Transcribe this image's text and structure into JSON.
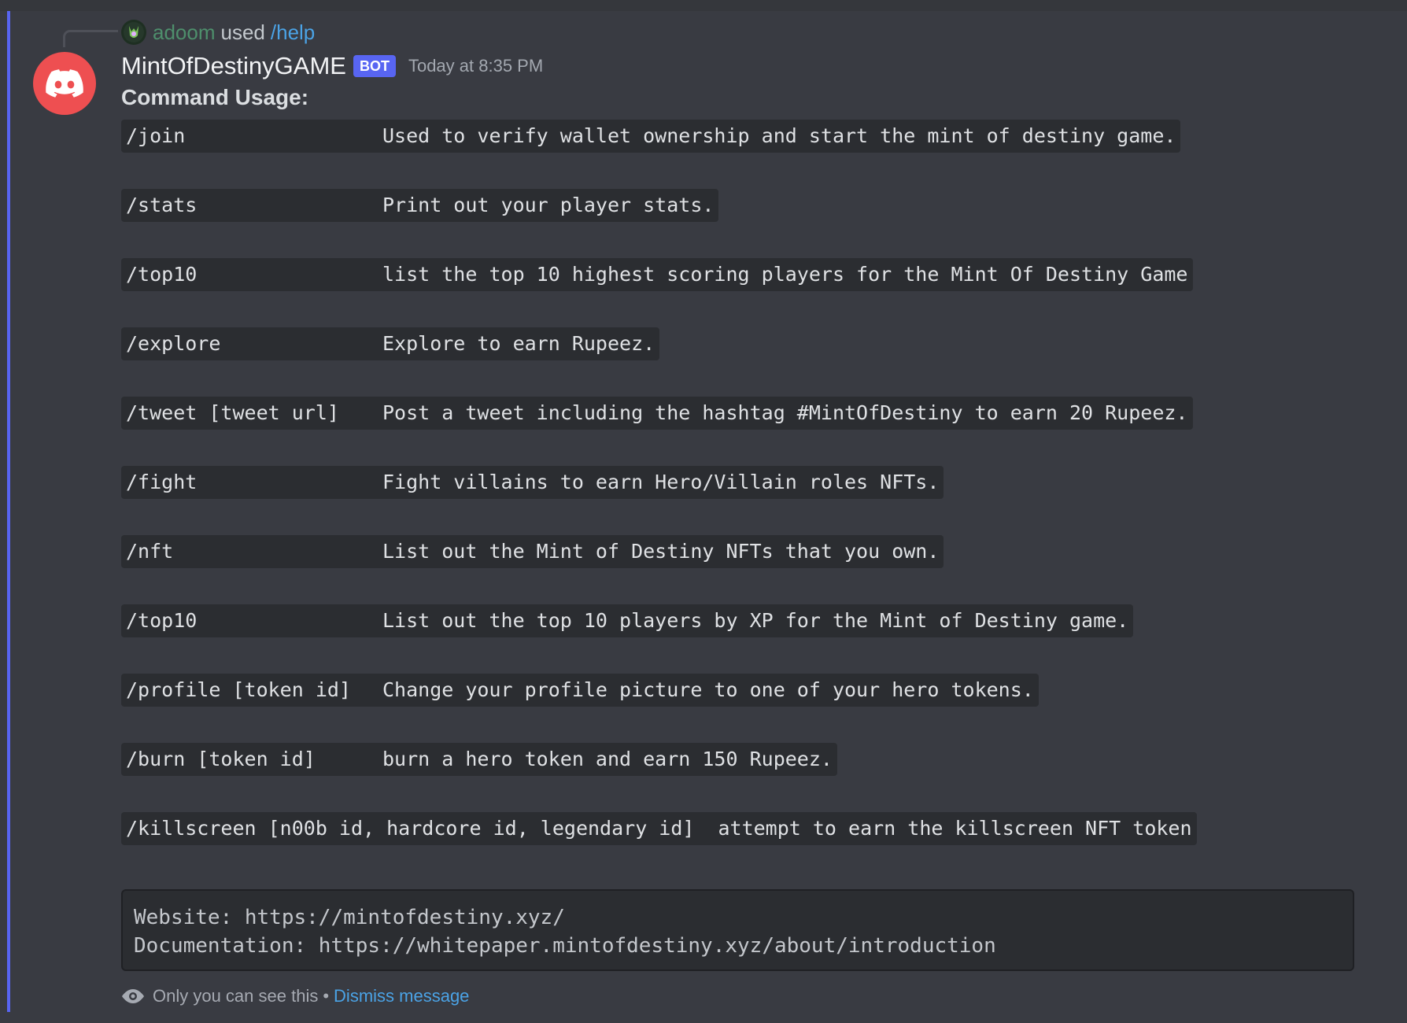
{
  "reply": {
    "username": "adoom",
    "used_text": "used",
    "command": "/help"
  },
  "message": {
    "author": "MintOfDestinyGAME",
    "bot_tag": "BOT",
    "timestamp": "Today at 8:35 PM",
    "title": "Command Usage:",
    "commands": [
      {
        "name": "/join",
        "description": "Used to verify wallet ownership and start the mint of destiny game."
      },
      {
        "name": "/stats",
        "description": "Print out your player stats."
      },
      {
        "name": "/top10",
        "description": "list the top 10 highest scoring players for the Mint Of Destiny Game"
      },
      {
        "name": "/explore",
        "description": "Explore to earn Rupeez."
      },
      {
        "name": "/tweet [tweet url]",
        "description": "Post a tweet including the hashtag #MintOfDestiny to earn 20 Rupeez."
      },
      {
        "name": "/fight",
        "description": "Fight villains to earn Hero/Villain roles NFTs."
      },
      {
        "name": "/nft",
        "description": "List out the Mint of Destiny NFTs that you own."
      },
      {
        "name": "/top10",
        "description": "List out the top 10 players by XP for the Mint of Destiny game."
      },
      {
        "name": "/profile [token id]",
        "description": "Change your profile picture to one of your hero tokens."
      },
      {
        "name": "/burn [token id]",
        "description": "burn a hero token and earn 150 Rupeez."
      },
      {
        "name": "/killscreen [n00b id, hardcore id, legendary id]",
        "description": "attempt to earn the killscreen NFT token"
      }
    ],
    "code_block": {
      "line1": "Website: https://mintofdestiny.xyz/",
      "line2": "Documentation: https://whitepaper.mintofdestiny.xyz/about/introduction"
    },
    "ephemeral_note": "Only you can see this",
    "separator": "•",
    "dismiss_label": "Dismiss message"
  },
  "colors": {
    "accent": "#5865f2",
    "link": "#4ba3e6",
    "avatar_bg": "#ee4f51"
  },
  "icons": {
    "reply_avatar": "user-avatar-icon",
    "bot_avatar": "discord-logo-icon",
    "ephemeral": "eye-icon"
  }
}
